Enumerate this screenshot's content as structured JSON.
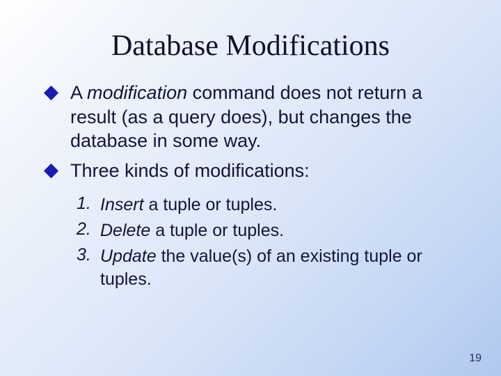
{
  "title": "Database Modifications",
  "bullets": [
    {
      "pre": "A ",
      "em": "modification ",
      "post": " command does not return a result (as a query does), but changes the database in some way."
    },
    {
      "pre": "",
      "em": "",
      "post": "Three kinds of modifications:"
    }
  ],
  "numbered": [
    {
      "n": "1.",
      "em": "Insert ",
      "rest": " a tuple or tuples."
    },
    {
      "n": "2.",
      "em": "Delete ",
      "rest": " a tuple or tuples."
    },
    {
      "n": "3.",
      "em": "Update ",
      "rest": " the value(s) of an existing tuple or tuples."
    }
  ],
  "page_number": "19"
}
